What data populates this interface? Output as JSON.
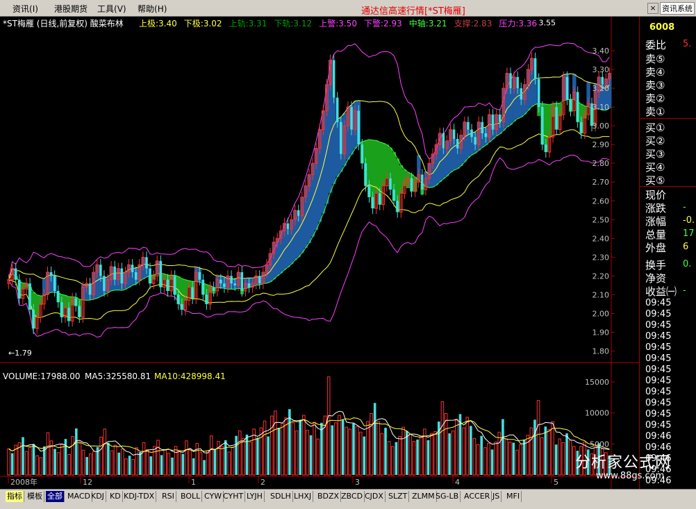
{
  "menu": {
    "items": [
      "资讯",
      "港股期货",
      "工具",
      "帮助"
    ],
    "shortcuts": [
      "(I)",
      "",
      "(V)",
      "(H)"
    ]
  },
  "app_title": "通达信高速行情[*ST梅雁]",
  "window_button": "×",
  "sys_button": "资讯系统",
  "chart_data": [
    {
      "type": "candlestick",
      "title": "*ST梅雁 (日线,前复权) 酸菜布林",
      "indicators": [
        {
          "label": "上极:",
          "value": "3.40",
          "color": "#ffff40"
        },
        {
          "label": "下极:",
          "value": "3.02",
          "color": "#ffff40"
        },
        {
          "label": "上轨:",
          "value": "3.31",
          "color": "#00a000"
        },
        {
          "label": "下轨:",
          "value": "3.12",
          "color": "#00a000"
        },
        {
          "label": "上警:",
          "value": "3.50",
          "color": "#ff40ff"
        },
        {
          "label": "下警:",
          "value": "2.93",
          "color": "#ff40ff"
        },
        {
          "label": "中轴:",
          "value": "3.21",
          "color": "#40ff40"
        },
        {
          "label": "支撑:",
          "value": "2.83",
          "color": "#c04040"
        },
        {
          "label": "压力:",
          "value": "3.36",
          "color": "#ff40ff"
        }
      ],
      "ylim": [
        1.75,
        3.5
      ],
      "yticks": [
        "3.40",
        "3.30",
        "3.20",
        "3.10",
        "3.00",
        "2.90",
        "2.80",
        "2.70",
        "2.60",
        "2.50",
        "2.40",
        "2.30",
        "2.20",
        "2.10",
        "2.00",
        "1.90",
        "1.80"
      ],
      "annotations": {
        "high": "3.55",
        "low": "1.79"
      },
      "close": [
        2.18,
        2.24,
        2.18,
        2.08,
        2.13,
        2.16,
        2.02,
        1.92,
        1.98,
        2.05,
        2.1,
        2.22,
        2.2,
        2.12,
        2.06,
        1.98,
        2.03,
        1.96,
        2.08,
        2.04,
        1.98,
        2.14,
        2.16,
        2.1,
        2.22,
        2.26,
        2.2,
        2.12,
        2.18,
        2.25,
        2.18,
        2.24,
        2.16,
        2.22,
        2.26,
        2.22,
        2.18,
        2.26,
        2.3,
        2.24,
        2.16,
        2.2,
        2.28,
        2.14,
        2.18,
        2.12,
        2.2,
        2.1,
        2.05,
        2.02,
        2.07,
        2.14,
        2.08,
        2.22,
        2.18,
        2.1,
        2.05,
        2.14,
        2.12,
        2.18,
        2.16,
        2.14,
        2.2,
        2.16,
        2.15,
        2.22,
        2.12,
        2.16,
        2.14,
        2.16,
        2.2,
        2.16,
        2.22,
        2.26,
        2.32,
        2.38,
        2.4,
        2.44,
        2.48,
        2.45,
        2.5,
        2.55,
        2.52,
        2.62,
        2.68,
        2.74,
        2.8,
        2.88,
        2.98,
        3.08,
        3.22,
        3.35,
        3.15,
        3.02,
        2.85,
        3.0,
        3.1,
        2.98,
        3.08,
        2.9,
        2.8,
        2.68,
        2.62,
        2.56,
        2.64,
        2.58,
        2.68,
        2.72,
        2.66,
        2.6,
        2.54,
        2.64,
        2.7,
        2.72,
        2.65,
        2.7,
        2.74,
        2.66,
        2.72,
        2.8,
        2.85,
        2.9,
        2.96,
        2.88,
        2.92,
        2.98,
        2.93,
        2.88,
        2.95,
        3.02,
        2.98,
        2.94,
        2.9,
        3.02,
        2.96,
        2.94,
        3.06,
        2.98,
        3.06,
        3.02,
        3.2,
        3.28,
        3.2,
        3.26,
        3.2,
        3.14,
        3.22,
        3.3,
        3.36,
        3.25,
        3.1,
        2.9,
        2.86,
        2.94,
        3.1,
        2.98,
        3.06,
        3.26,
        3.14,
        3.08,
        3.18,
        3.02,
        2.96,
        3.06,
        3.12,
        3.0,
        3.18,
        3.26,
        3.22,
        3.25,
        3.28
      ]
    },
    {
      "type": "bar",
      "title": "VOLUME:17988.00",
      "ma5": "MA5:325580.81",
      "ma10": "MA10:428998.41",
      "ylim": [
        0,
        17000
      ],
      "yticks": [
        "15000",
        "10000",
        "5000"
      ],
      "xticks": [
        "2008年",
        "12",
        "1",
        "2",
        "3",
        "4",
        "5"
      ],
      "values": [
        4200,
        3500,
        4800,
        5200,
        6100,
        3800,
        4400,
        5000,
        3100,
        2800,
        4600,
        6800,
        5500,
        4200,
        3600,
        4900,
        5800,
        3300,
        6200,
        7500,
        5100,
        4000,
        2900,
        3400,
        3800,
        4500,
        6100,
        7400,
        5200,
        3900,
        4800,
        3600,
        4200,
        2600,
        3100,
        2500,
        4400,
        3700,
        5200,
        4100,
        3000,
        4600,
        5600,
        3200,
        4000,
        3500,
        2800,
        4600,
        3900,
        3400,
        5500,
        4100,
        2700,
        5100,
        3600,
        2400,
        3900,
        6300,
        4200,
        5400,
        4600,
        5600,
        3700,
        4500,
        6300,
        7100,
        5900,
        6500,
        5300,
        7400,
        6000,
        7600,
        8700,
        6200,
        9500,
        10300,
        7600,
        8300,
        9200,
        10600,
        8400,
        7100,
        8800,
        9600,
        7200,
        6400,
        8500,
        5800,
        8400,
        9500,
        15800,
        8000,
        8400,
        9600,
        8900,
        7700,
        7400,
        8300,
        7800,
        6900,
        6200,
        8600,
        9900,
        11600,
        8600,
        6700,
        7600,
        5400,
        4600,
        5300,
        6200,
        7700,
        7100,
        6600,
        5400,
        5700,
        6300,
        7400,
        5600,
        6700,
        7000,
        8600,
        11800,
        9900,
        6700,
        7100,
        9000,
        9800,
        7600,
        9300,
        7900,
        5900,
        4900,
        6300,
        4400,
        5100,
        4100,
        5300,
        6900,
        9000,
        5800,
        5300,
        5200,
        4000,
        4900,
        5700,
        6400,
        7600,
        8900,
        12000,
        6000,
        7800,
        7300,
        8600,
        4900,
        5800,
        5200,
        6700,
        5600,
        4600,
        3900,
        4600,
        5300,
        4100,
        3400,
        4600,
        5100,
        4200,
        3600,
        3000
      ]
    }
  ],
  "quote_panel": {
    "code": "6008",
    "ratio_label": "委比",
    "ratio_value": "5.",
    "sells": [
      "卖⑤",
      "卖④",
      "卖③",
      "卖②",
      "卖①"
    ],
    "buys": [
      "买①",
      "买②",
      "买③",
      "买④",
      "买⑤"
    ],
    "stats": [
      {
        "label": "现价",
        "value": ""
      },
      {
        "label": "涨跌",
        "value": "-"
      },
      {
        "label": "涨幅",
        "value": "-0."
      },
      {
        "label": "总量",
        "value": "17"
      },
      {
        "label": "外盘",
        "value": "6"
      },
      {
        "label": "换手",
        "value": "0."
      },
      {
        "label": "净资",
        "value": ""
      },
      {
        "label": "收益㈠",
        "value": "-"
      }
    ],
    "ticks": [
      "09:45",
      "09:45",
      "09:45",
      "09:45",
      "09:45",
      "09:45",
      "09:45",
      "09:45",
      "09:45",
      "09:45",
      "09:45",
      "09:45",
      "09:46",
      "09:46",
      "09:46",
      "09:46",
      "09:46"
    ]
  },
  "tabs": [
    "指标",
    "模板",
    "全部",
    "MACD",
    "KDJ",
    "KD",
    "KDJ-TDX",
    "RSI",
    "BOLL",
    "CYW",
    "CYHT",
    "LYJH",
    "SDLH",
    "LHXJ",
    "BDZX",
    "ZBCD",
    "CJDX",
    "SLZT",
    "ZLMM",
    "SG-LB",
    "ACCER",
    "JS",
    "MFI"
  ],
  "watermark": {
    "brand": "分析家公式网",
    "url": "www.88gs.com"
  },
  "colors": {
    "up": "#ff3030",
    "down": "#40e0e0",
    "band_blue": "#1e5aa0",
    "band_green": "#1aa01a",
    "axis": "#b00000",
    "ma": "#ffffff",
    "ma2": "#ffff40"
  }
}
